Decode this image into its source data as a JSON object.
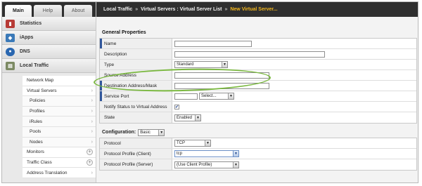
{
  "tabs": [
    {
      "label": "Main",
      "active": true
    },
    {
      "label": "Help",
      "active": false
    },
    {
      "label": "About",
      "active": false
    }
  ],
  "nav": {
    "sections": [
      {
        "label": "Statistics",
        "icon": "statistics-icon"
      },
      {
        "label": "iApps",
        "icon": "iapps-icon"
      },
      {
        "label": "DNS",
        "icon": "dns-icon"
      },
      {
        "label": "Local Traffic",
        "icon": "local-traffic-icon"
      }
    ],
    "items": [
      {
        "label": "Network Map",
        "indicator": ""
      },
      {
        "label": "Virtual Servers",
        "indicator": "›"
      },
      {
        "label": "Policies",
        "indicator": "›"
      },
      {
        "label": "Profiles",
        "indicator": "›"
      },
      {
        "label": "iRules",
        "indicator": "›"
      },
      {
        "label": "Pools",
        "indicator": "›"
      },
      {
        "label": "Nodes",
        "indicator": "›"
      },
      {
        "label": "Monitors",
        "indicator": "+"
      },
      {
        "label": "Traffic Class",
        "indicator": "+"
      },
      {
        "label": "Address Translation",
        "indicator": "›"
      }
    ]
  },
  "breadcrumb": {
    "part1": "Local Traffic",
    "sep1": "»",
    "part2": "Virtual Servers : Virtual Server List",
    "sep2": "»",
    "current": "New Virtual Server..."
  },
  "general": {
    "title": "General Properties",
    "fields": {
      "name": {
        "label": "Name",
        "value": ""
      },
      "description": {
        "label": "Description",
        "value": ""
      },
      "type": {
        "label": "Type",
        "value": "Standard"
      },
      "source": {
        "label": "Source Address",
        "value": ""
      },
      "destination": {
        "label": "Destination Address/Mask",
        "value": ""
      },
      "port": {
        "label": "Service Port",
        "value": "",
        "select": "Select..."
      },
      "notify": {
        "label": "Notify Status to Virtual Address",
        "checked": "✔"
      },
      "state": {
        "label": "State",
        "value": "Enabled"
      }
    }
  },
  "configuration": {
    "label": "Configuration:",
    "mode": "Basic",
    "fields": {
      "protocol": {
        "label": "Protocol",
        "value": "TCP"
      },
      "client": {
        "label": "Protocol Profile (Client)",
        "value": "tcp"
      },
      "server": {
        "label": "Protocol Profile (Server)",
        "value": "(Use Client Profile)"
      }
    }
  },
  "colors": {
    "accent": "#f1b51c",
    "annotation": "#7ab83f",
    "required": "#30569b"
  }
}
